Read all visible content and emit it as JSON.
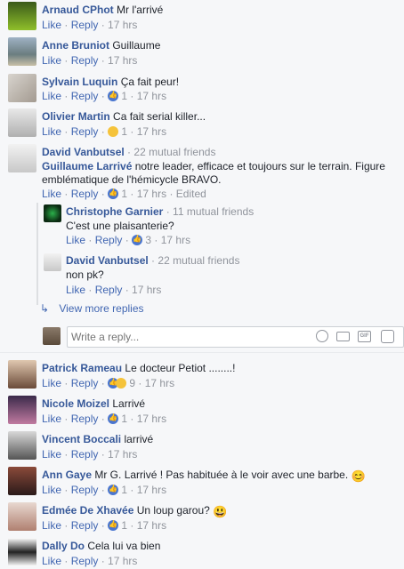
{
  "actions": {
    "like": "Like",
    "reply": "Reply"
  },
  "comments": [
    {
      "name": "Arnaud CPhot",
      "text": "Mr l'arrivé",
      "count": "",
      "time": "17 hrs"
    },
    {
      "name": "Anne Bruniot",
      "text": "Guillaume",
      "count": "",
      "time": "17 hrs"
    },
    {
      "name": "Sylvain Luquin",
      "text": "Ça fait peur!",
      "count": "1",
      "time": "17 hrs"
    },
    {
      "name": "Olivier Martin",
      "text": "Ca fait serial killer...",
      "count": "1",
      "time": "17 hrs"
    },
    {
      "name": "David Vanbutsel",
      "mutual": "22 mutual friends",
      "tag": "Guillaume Larrivé",
      "text1": " notre leader, efficace et toujours sur le terrain. Figure",
      "text2": "emblématique de l'hémicycle BRAVO.",
      "count": "1",
      "time": "17 hrs",
      "edited": "Edited"
    },
    {
      "name": "Patrick Rameau",
      "text": "Le docteur Petiot ........!",
      "count": "9",
      "time": "17 hrs"
    },
    {
      "name": "Nicole Moizel",
      "text": "Larrivé",
      "count": "1",
      "time": "17 hrs"
    },
    {
      "name": "Vincent Boccali",
      "text": "larrivé",
      "count": "",
      "time": "17 hrs"
    },
    {
      "name": "Ann Gaye",
      "text": "Mr G. Larrivé ! Pas habituée à le voir avec une barbe.",
      "count": "1",
      "time": "17 hrs"
    },
    {
      "name": "Edmée De Xhavée",
      "text": "Un loup garou?",
      "count": "1",
      "time": "17 hrs"
    },
    {
      "name": "Dally Do",
      "text": "Cela lui va bien",
      "count": "",
      "time": "17 hrs"
    }
  ],
  "replies": [
    {
      "name": "Christophe Garnier",
      "mutual": "11 mutual friends",
      "text": "C'est une plaisanterie?",
      "count": "3",
      "time": "17 hrs"
    },
    {
      "name": "David Vanbutsel",
      "mutual": "22 mutual friends",
      "text": "non pk?",
      "time": "17 hrs"
    }
  ],
  "view_more": "View more replies",
  "reply_box": {
    "placeholder": "Write a reply..."
  },
  "icons": [
    "smiley-icon",
    "camera-icon",
    "gif-icon",
    "sticker-icon"
  ]
}
